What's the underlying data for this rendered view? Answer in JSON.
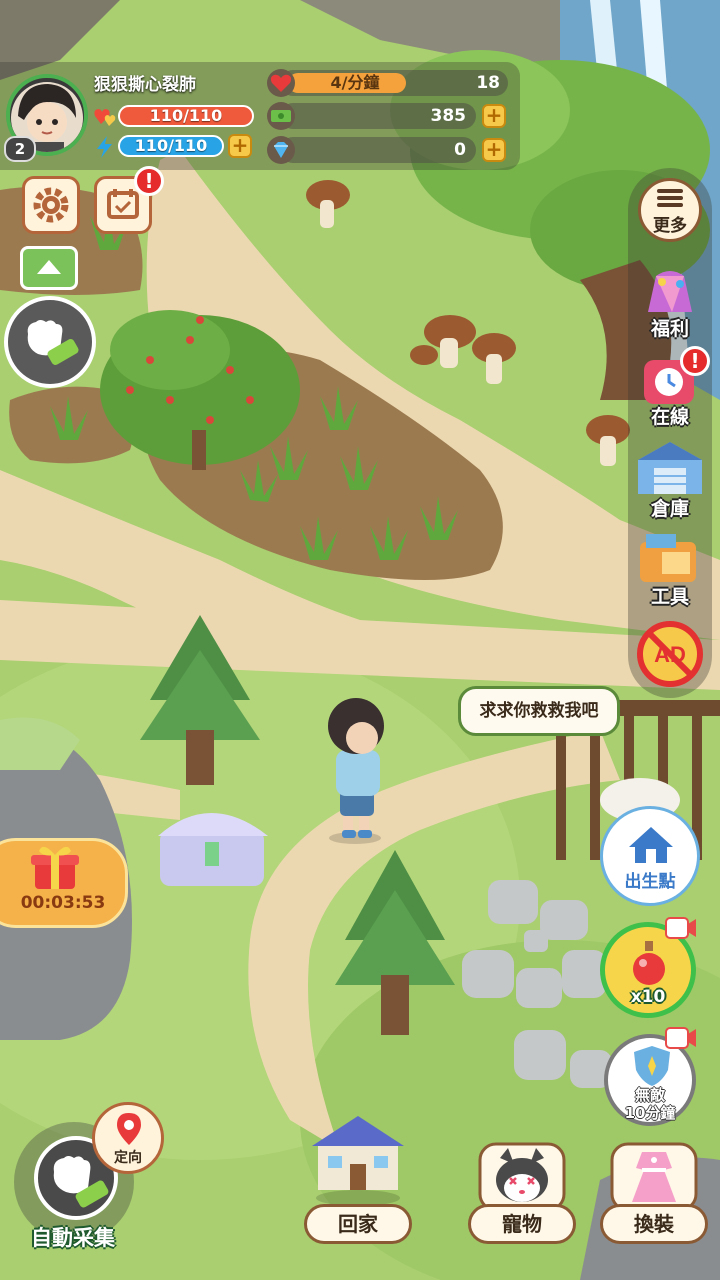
{
  "player": {
    "name": "狠狠撕心裂肺",
    "level": "2",
    "hp": "110/110",
    "energy": "110/110"
  },
  "resources": {
    "heart_rate": "4/分鐘",
    "heart_count": "18",
    "cash": "385",
    "gems": "0"
  },
  "side_menu": {
    "more": "更多",
    "welfare": "福利",
    "online": "在線",
    "warehouse": "倉庫",
    "tools": "工具",
    "no_ads": "AD"
  },
  "speech_bubble": "求求你救救我吧",
  "gift_timer": "00:03:53",
  "spawn_button": "出生點",
  "potion_count": "x10",
  "invincible_line1": "無敵",
  "invincible_line2": "10分鐘",
  "auto_collect": "自動采集",
  "locate": "定向",
  "bottom_nav": {
    "home": "回家",
    "pet": "寵物",
    "outfit": "換裝"
  },
  "colors": {
    "hp_bar": "#ef5a3c",
    "energy_bar": "#28a4e6",
    "heart_bar": "#f5a23c",
    "grass": "#a8cf6e",
    "path": "#ecd8b0"
  }
}
